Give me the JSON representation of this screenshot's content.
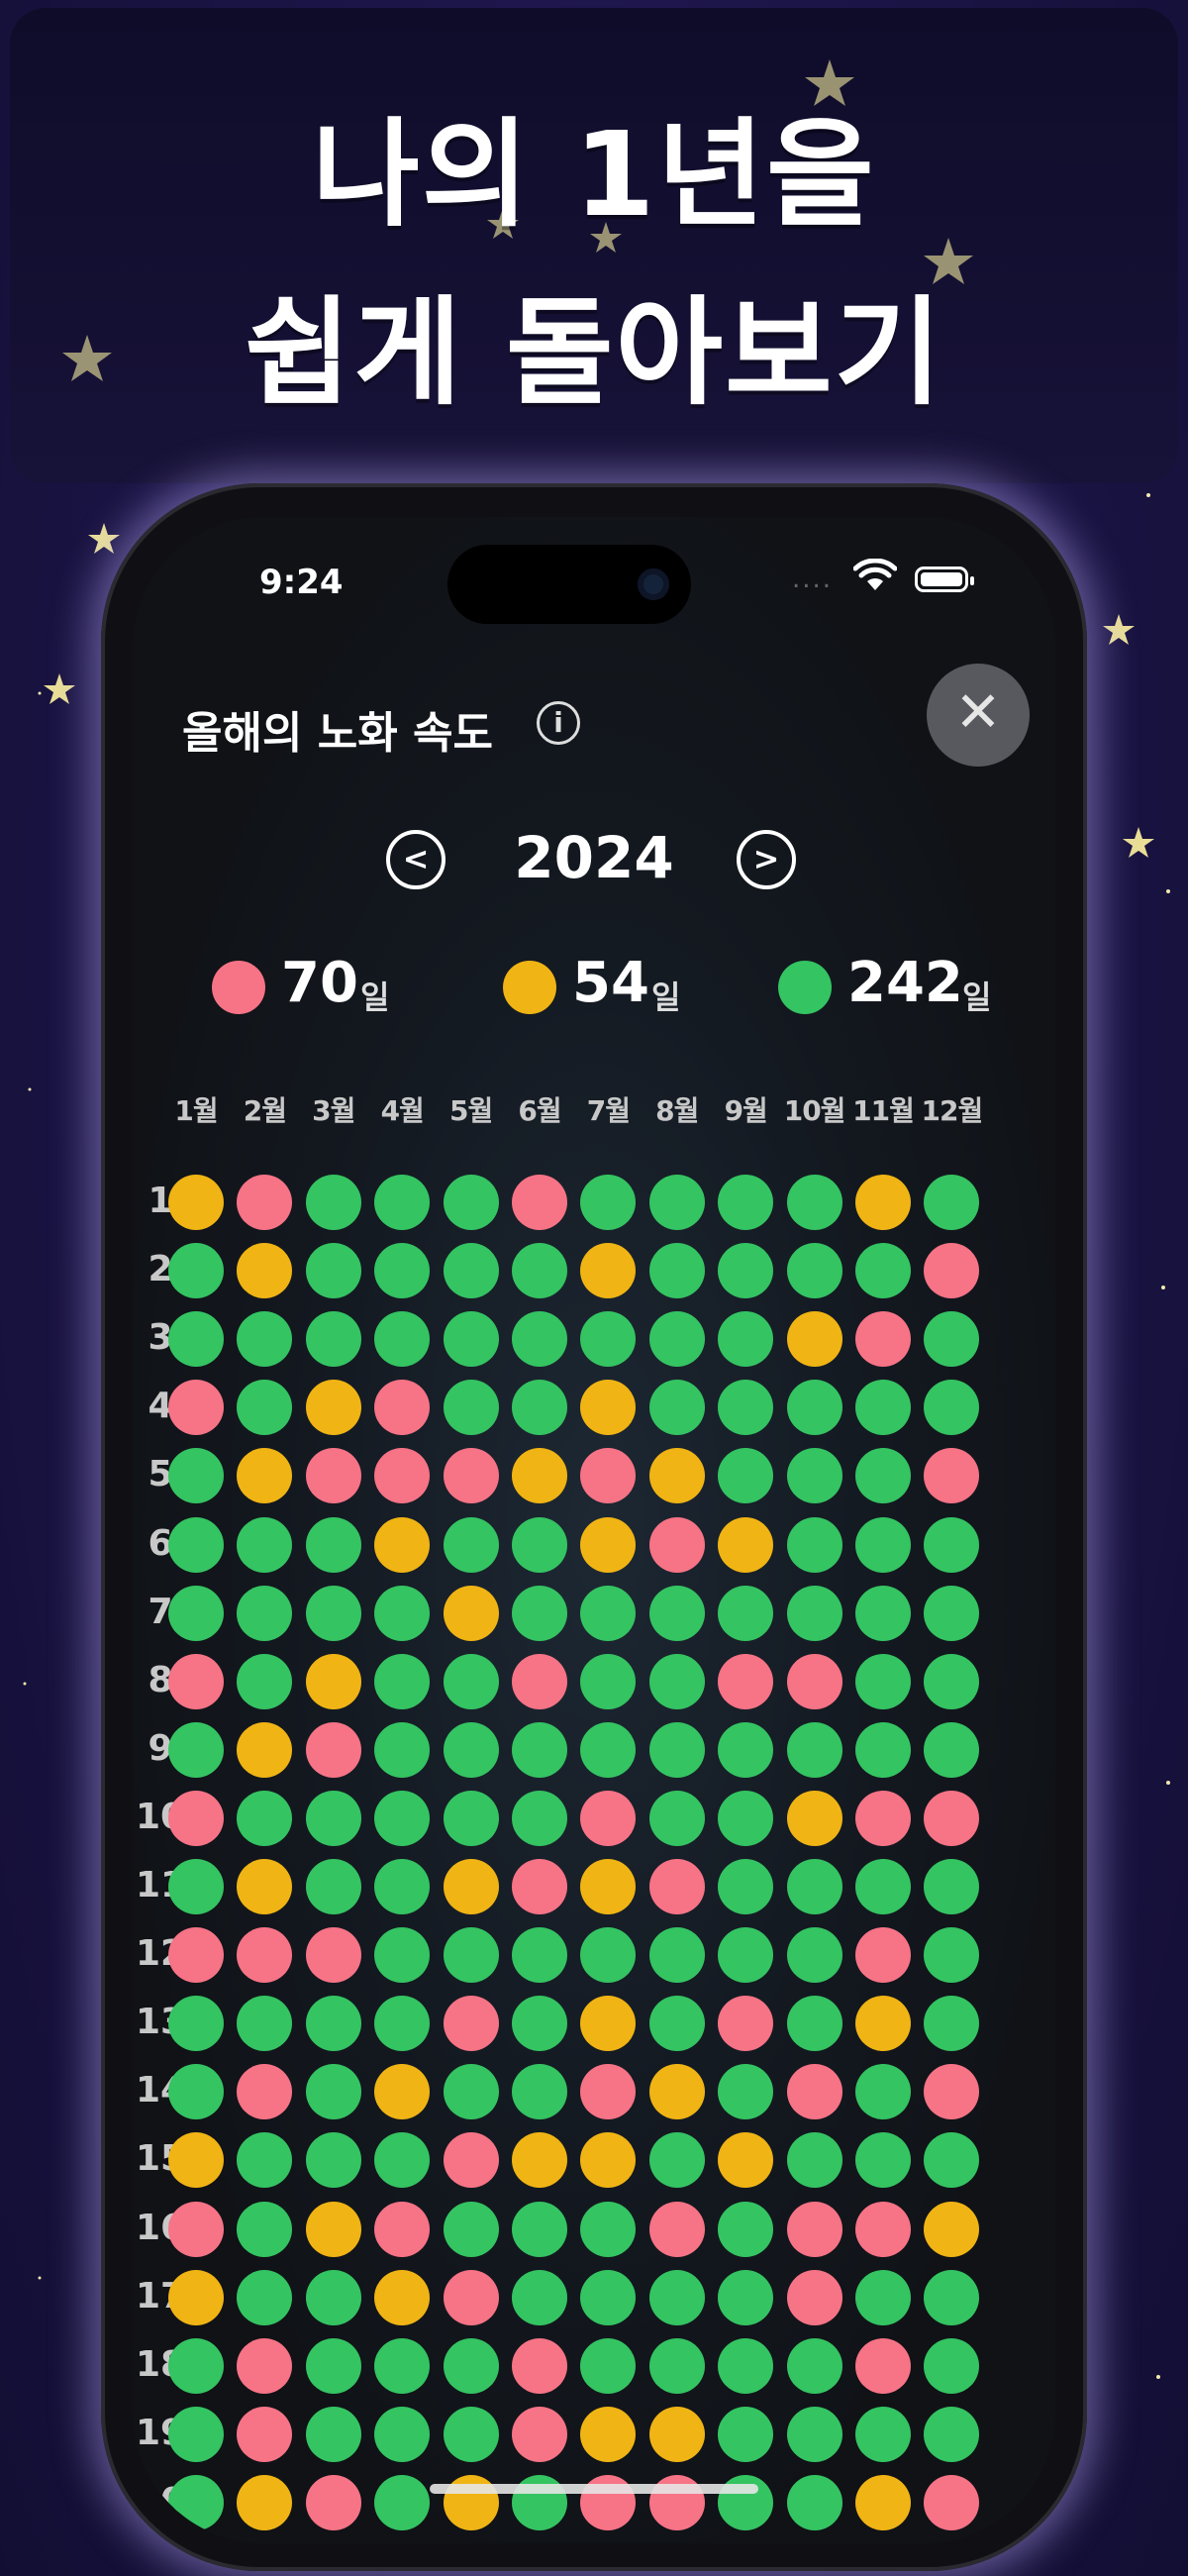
{
  "promo": {
    "headline_line1": "나의 1년을",
    "headline_line2": "쉽게 돌아보기"
  },
  "status_bar": {
    "time": "9:24",
    "signal": "....",
    "icons": [
      "wifi-icon",
      "battery-icon"
    ]
  },
  "header": {
    "title": "올해의 노화 속도",
    "info_icon": "info-icon",
    "info_glyph": "i",
    "close_icon": "close-icon",
    "close_glyph": "✕"
  },
  "year_nav": {
    "year": "2024",
    "prev_glyph": "<",
    "next_glyph": ">"
  },
  "stats": [
    {
      "count": "70",
      "unit": "일",
      "color": "#f77386"
    },
    {
      "count": "54",
      "unit": "일",
      "color": "#f0b414"
    },
    {
      "count": "242",
      "unit": "일",
      "color": "#34c462"
    }
  ],
  "colors": {
    "P": "#f77386",
    "Y": "#f0b414",
    "G": "#34c462"
  },
  "months": [
    "1월",
    "2월",
    "3월",
    "4월",
    "5월",
    "6월",
    "7월",
    "8월",
    "9월",
    "10월",
    "11월",
    "12월"
  ],
  "days": [
    "1",
    "2",
    "3",
    "4",
    "5",
    "6",
    "7",
    "8",
    "9",
    "10",
    "11",
    "12",
    "13",
    "14",
    "15",
    "16",
    "17",
    "18",
    "19",
    "20"
  ],
  "grid": [
    "YPGGGPGGGGYG",
    "GYGGGGYGGGGP",
    "GGGGGGGGGYPG",
    "PGYPGGYGGGGG",
    "GYPPPYPYGGGP",
    "GGGYGGYPYGGG",
    "GGGGYGGGGGGG",
    "PGYGGPGGPPGG",
    "GYPGGGGGGGGG",
    "PGGGGGPGGYPP",
    "GYGGYPYPGGGG",
    "PPPGGGGGGGPG",
    "GGGGPGYGPGYG",
    "GPGYGGPYGPGP",
    "YGGGPYYGYGGG",
    "PGYPGGGPGPPY",
    "YGGYPGGGGPGG",
    "GPGGGPGGGGPG",
    "GPGGGPYYGGGG",
    "GYPGYGPPGGYP"
  ]
}
